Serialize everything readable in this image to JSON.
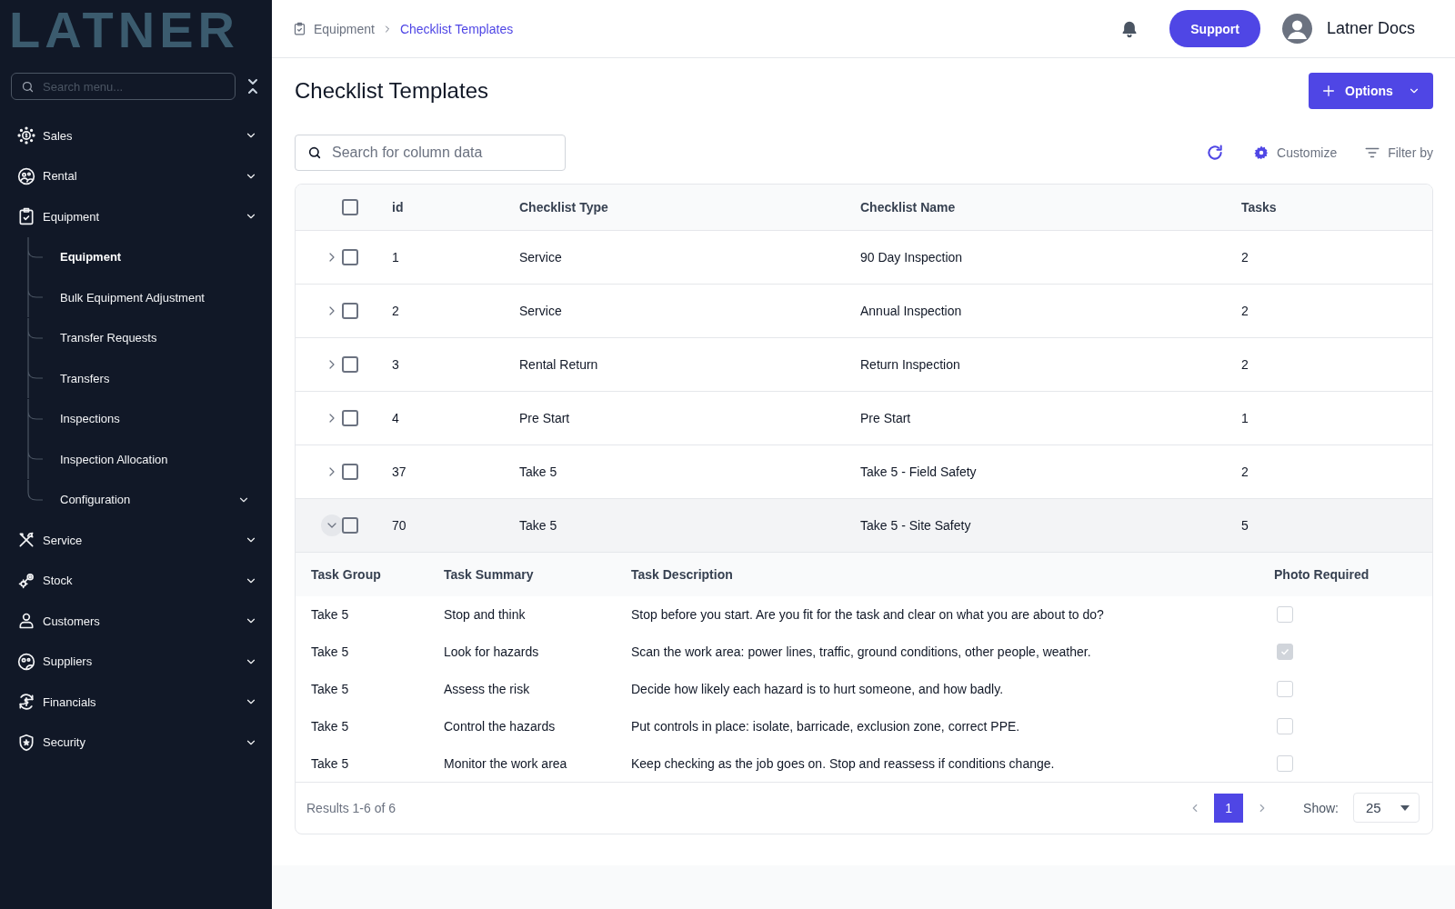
{
  "logo": "LATNER",
  "sidebar": {
    "search": {
      "placeholder": "Search menu..."
    },
    "items": [
      {
        "label": "Sales",
        "kind": "sales"
      },
      {
        "label": "Rental",
        "kind": "rental"
      },
      {
        "label": "Equipment",
        "kind": "equipment",
        "children": [
          {
            "label": "Equipment",
            "selected": true,
            "expandable": false
          },
          {
            "label": "Bulk Equipment Adjustment",
            "selected": false,
            "expandable": false
          },
          {
            "label": "Transfer Requests",
            "selected": false,
            "expandable": false
          },
          {
            "label": "Transfers",
            "selected": false,
            "expandable": false
          },
          {
            "label": "Inspections",
            "selected": false,
            "expandable": false
          },
          {
            "label": "Inspection Allocation",
            "selected": false,
            "expandable": false
          },
          {
            "label": "Configuration",
            "selected": false,
            "expandable": true
          }
        ]
      },
      {
        "label": "Service",
        "kind": "service"
      },
      {
        "label": "Stock",
        "kind": "stock"
      },
      {
        "label": "Customers",
        "kind": "customers"
      },
      {
        "label": "Suppliers",
        "kind": "suppliers"
      },
      {
        "label": "Financials",
        "kind": "financials"
      },
      {
        "label": "Security",
        "kind": "security"
      }
    ]
  },
  "header": {
    "breadcrumb": [
      {
        "label": "Equipment",
        "current": false
      },
      {
        "label": "Checklist Templates",
        "current": true
      }
    ],
    "support_button": "Support",
    "user_name": "Latner Docs"
  },
  "page": {
    "title": "Checklist Templates",
    "options_button": "Options"
  },
  "toolbar": {
    "search": {
      "placeholder": "Search for column data"
    },
    "customize": "Customize",
    "filter": "Filter by"
  },
  "table": {
    "columns": [
      "id",
      "Checklist Type",
      "Checklist Name",
      "Tasks"
    ],
    "all_checked": false,
    "rows": [
      {
        "id": "1",
        "type": "Service",
        "name": "90 Day Inspection",
        "tasks": "2",
        "checked": false,
        "expanded": false
      },
      {
        "id": "2",
        "type": "Service",
        "name": "Annual Inspection",
        "tasks": "2",
        "checked": false,
        "expanded": false
      },
      {
        "id": "3",
        "type": "Rental Return",
        "name": "Return Inspection",
        "tasks": "2",
        "checked": false,
        "expanded": false
      },
      {
        "id": "4",
        "type": "Pre Start",
        "name": "Pre Start",
        "tasks": "1",
        "checked": false,
        "expanded": false
      },
      {
        "id": "37",
        "type": "Take 5",
        "name": "Take 5 - Field Safety",
        "tasks": "2",
        "checked": false,
        "expanded": false
      },
      {
        "id": "70",
        "type": "Take 5",
        "name": "Take 5 - Site Safety",
        "tasks": "5",
        "checked": false,
        "expanded": true,
        "detail": {
          "columns": [
            "Task Group",
            "Task Summary",
            "Task Description",
            "Photo Required"
          ],
          "rows": [
            {
              "group": "Take 5",
              "summary": "Stop and think",
              "description": "Stop before you start. Are you fit for the task and clear on what you are about to do?",
              "photo_required": false
            },
            {
              "group": "Take 5",
              "summary": "Look for hazards",
              "description": "Scan the work area: power lines, traffic, ground conditions, other people, weather.",
              "photo_required": true
            },
            {
              "group": "Take 5",
              "summary": "Assess the risk",
              "description": "Decide how likely each hazard is to hurt someone, and how badly.",
              "photo_required": false
            },
            {
              "group": "Take 5",
              "summary": "Control the hazards",
              "description": "Put controls in place: isolate, barricade, exclusion zone, correct PPE.",
              "photo_required": false
            },
            {
              "group": "Take 5",
              "summary": "Monitor the work area",
              "description": "Keep checking as the job goes on. Stop and reassess if conditions change.",
              "photo_required": false
            }
          ]
        }
      }
    ]
  },
  "footer": {
    "results": "Results 1-6 of 6",
    "pages": [
      {
        "label": "1",
        "selected": true
      }
    ],
    "show_label": "Show:",
    "page_size": "25"
  }
}
